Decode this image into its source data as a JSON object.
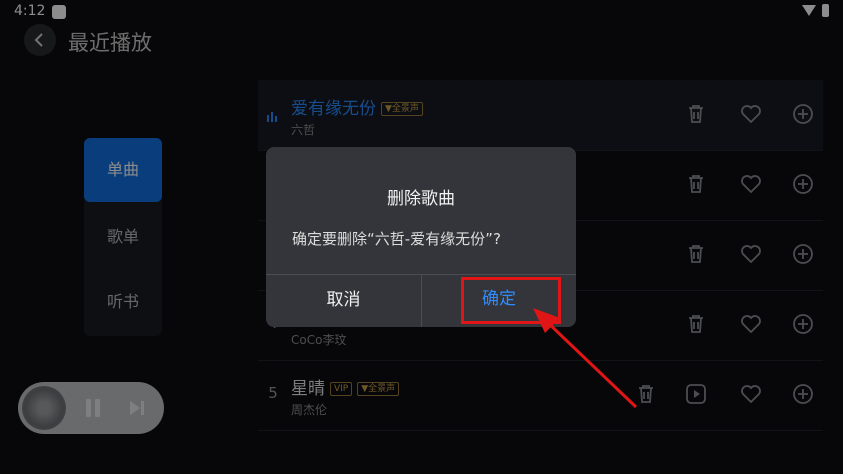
{
  "status": {
    "time": "4:12"
  },
  "header": {
    "title": "最近播放"
  },
  "tabs": [
    {
      "label": "单曲",
      "active": true
    },
    {
      "label": "歌单",
      "active": false
    },
    {
      "label": "听书",
      "active": false
    }
  ],
  "songs": [
    {
      "index": "",
      "title": "爱有缘无份",
      "artist": "六哲",
      "badges": [
        "▼全景声"
      ],
      "playing": true
    },
    {
      "index": "",
      "title": "",
      "artist": "",
      "badges": []
    },
    {
      "index": "",
      "title": "",
      "artist": "",
      "badges": []
    },
    {
      "index": "4",
      "title": "",
      "artist": "CoCo李玟",
      "badges": []
    },
    {
      "index": "5",
      "title": "星晴",
      "artist": "周杰伦",
      "badges": [
        "VIP",
        "▼全景声"
      ]
    }
  ],
  "dialog": {
    "title": "删除歌曲",
    "message": "确定要删除“六哲-爱有缘无份”?",
    "cancel": "取消",
    "confirm": "确定"
  },
  "colors": {
    "accent": "#1270e0",
    "highlight": "#e01515",
    "confirm_text": "#2f8cff"
  }
}
